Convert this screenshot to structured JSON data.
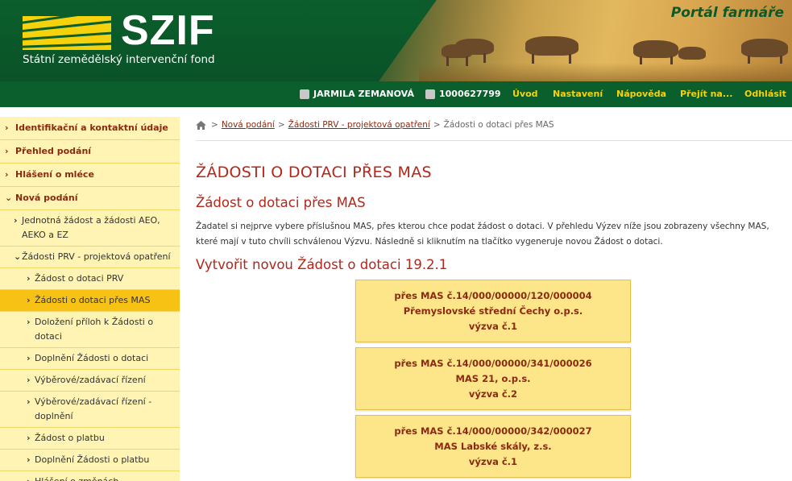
{
  "header": {
    "logo_text": "SZIF",
    "logo_subtitle": "Státní zemědělský intervenční fond",
    "portal_title": "Portál farmáře"
  },
  "navbar": {
    "user_name": "JARMILA ZEMANOVÁ",
    "user_id": "1000627799",
    "links": [
      "Úvod",
      "Nastavení",
      "Nápověda",
      "Přejít na...",
      "Odhlásit"
    ]
  },
  "sidebar": {
    "items": [
      {
        "label": "Identifikační a kontaktní údaje",
        "chevron": "›"
      },
      {
        "label": "Přehled podání",
        "chevron": "›"
      },
      {
        "label": "Hlášení o mléce",
        "chevron": "›"
      },
      {
        "label": "Nová podání",
        "chevron": "⌄"
      },
      {
        "label": "Jednotná žádost a žádosti AEO, AEKO a EZ",
        "chevron": "›"
      },
      {
        "label": "Žádosti PRV - projektová opatření",
        "chevron": "⌄"
      },
      {
        "label": "Žádost o dotaci PRV",
        "chevron": "›"
      },
      {
        "label": "Žádosti o dotaci přes MAS",
        "chevron": "›"
      },
      {
        "label": "Doložení příloh k Žádosti o dotaci",
        "chevron": "›"
      },
      {
        "label": "Doplnění Žádosti o dotaci",
        "chevron": "›"
      },
      {
        "label": "Výběrové/zadávací řízení",
        "chevron": "›"
      },
      {
        "label": "Výběrové/zadávací řízení - doplnění",
        "chevron": "›"
      },
      {
        "label": "Žádost o platbu",
        "chevron": "›"
      },
      {
        "label": "Doplnění Žádosti o platbu",
        "chevron": "›"
      },
      {
        "label": "Hlášení o změnách",
        "chevron": "›"
      }
    ]
  },
  "breadcrumb": {
    "items": [
      "Nová podání",
      "Žádosti PRV - projektová opatření",
      "Žádosti o dotaci přes MAS"
    ],
    "separator": ">"
  },
  "main": {
    "page_title": "ŽÁDOSTI O DOTACI PŘES MAS",
    "sub_title": "Žádost o dotaci přes MAS",
    "intro": "Žadatel si nejprve vybere příslušnou MAS, přes kterou chce podat žádost o dotaci. V přehledu Výzev níže jsou zobrazeny všechny MAS, které mají v tuto chvíli schválenou Výzvu. Následně si kliknutím na tlačítko vygeneruje novou Žádost o dotaci.",
    "create_title": "Vytvořit novou Žádost o dotaci 19.2.1",
    "mas_buttons": [
      {
        "line1": "přes MAS č.14/000/00000/120/000004",
        "line2": "Přemyslovské střední Čechy o.p.s.",
        "line3": "výzva č.1"
      },
      {
        "line1": "přes MAS č.14/000/00000/341/000026",
        "line2": "MAS 21, o.p.s.",
        "line3": "výzva č.2"
      },
      {
        "line1": "přes MAS č.14/000/00000/342/000027",
        "line2": "MAS Labské skály, z.s.",
        "line3": "výzva č.1"
      }
    ]
  },
  "colors": {
    "brand_green": "#0b5f2c",
    "brand_yellow": "#f5d20b",
    "title_red": "#b4261a",
    "sidebar_bg": "#fff4b4",
    "sidebar_active": "#f8c214",
    "button_bg": "#fde58a"
  }
}
